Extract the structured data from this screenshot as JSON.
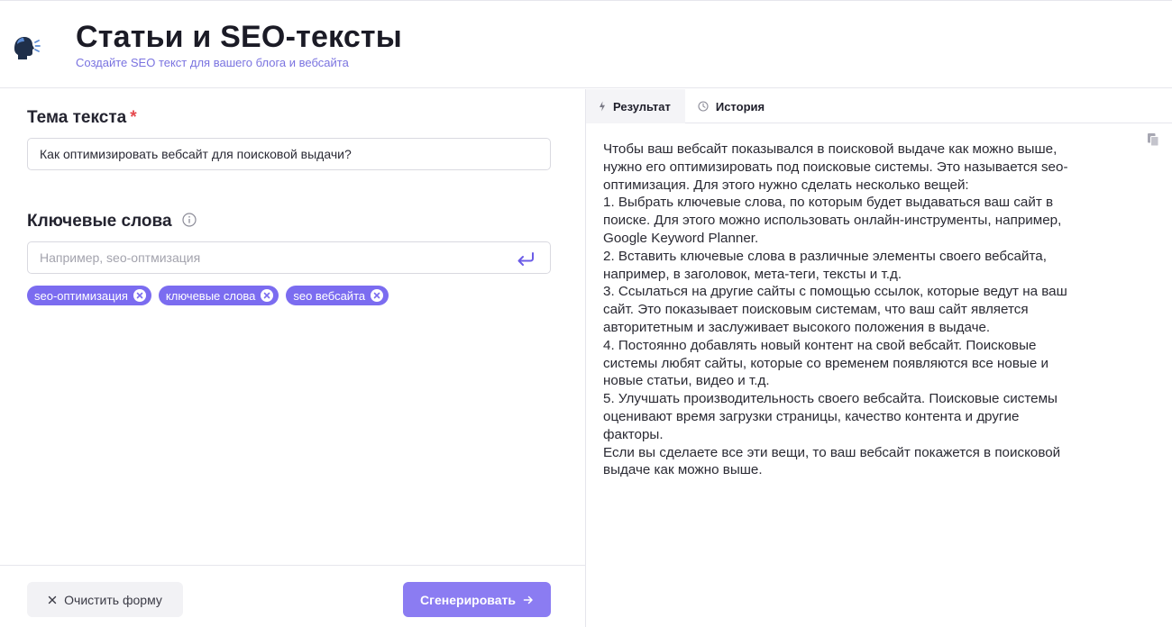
{
  "header": {
    "title": "Статьи и SEO-тексты",
    "subtitle": "Создайте SEO текст для вашего блога и вебсайта",
    "icon": "speaking-head-icon",
    "accent_color": "#7b6cf0"
  },
  "form": {
    "topic_label": "Тема текста",
    "topic_required_mark": "*",
    "topic_value": "Как оптимизировать вебсайт для поисковой выдачи?",
    "keywords_label": "Ключевые слова",
    "keywords_placeholder": "Например, seo-оптмизация",
    "tags": [
      {
        "label": "seo-оптимизация"
      },
      {
        "label": "ключевые слова"
      },
      {
        "label": "seo вебсайта"
      }
    ],
    "clear_button": "Очистить форму",
    "generate_button": "Сгенерировать"
  },
  "result": {
    "tabs": [
      {
        "label": "Результат",
        "icon": "bolt-icon",
        "active": true
      },
      {
        "label": "История",
        "icon": "clock-icon",
        "active": false
      }
    ],
    "text": "Чтобы ваш вебсайт показывался в поисковой выдаче как можно выше,\nнужно его оптимизировать под поисковые системы. Это называется seo-\nоптимизация. Для этого нужно сделать несколько вещей:\n1. Выбрать ключевые слова, по которым будет выдаваться ваш сайт в\nпоиске. Для этого можно использовать онлайн-инструменты, например,\nGoogle Keyword Planner.\n2. Вставить ключевые слова в различные элементы своего вебсайта,\nнапример, в заголовок, мета-теги, тексты и т.д.\n3. Ссылаться на другие сайты с помощью ссылок, которые ведут на ваш\nсайт. Это показывает поисковым системам, что ваш сайт является\nавторитетным и заслуживает высокого положения в выдаче.\n4. Постоянно добавлять новый контент на свой вебсайт. Поисковые\nсистемы любят сайты, которые со временем появляются все новые и\nновые статьи, видео и т.д.\n5. Улучшать производительность своего вебсайта. Поисковые системы\nоценивают время загрузки страницы, качество контента и другие\nфакторы.\nЕсли вы сделаете все эти вещи, то ваш вебсайт покажется в поисковой\nвыдаче как можно выше."
  }
}
